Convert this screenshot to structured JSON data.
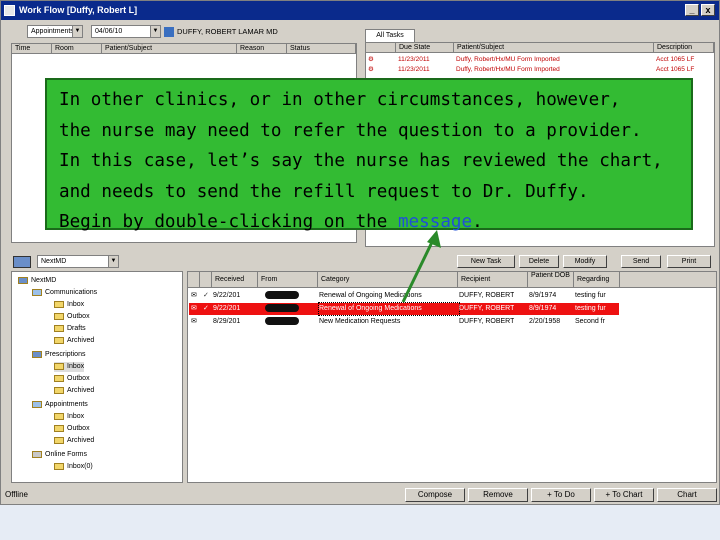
{
  "window": {
    "title": "Work Flow [Duffy, Robert L]",
    "minimize": "_",
    "close": "x"
  },
  "appointments": {
    "combo_label": "Appointments",
    "date_value": "04/06/10",
    "provider": "DUFFY, ROBERT LAMAR MD",
    "columns": [
      "Time",
      "Room",
      "Patient/Subject",
      "Reason",
      "Status"
    ]
  },
  "tasks": {
    "tab_label": "All Tasks",
    "columns": [
      "",
      "Due State",
      "Patient/Subject",
      "Description"
    ],
    "rows": [
      {
        "date": "11/23/2011",
        "subject": "Duffy, Robert/Hx/MU Form Imported",
        "desc": "Acct 1065 LF"
      },
      {
        "date": "11/23/2011",
        "subject": "Duffy, Robert/Hx/MU Form Imported",
        "desc": "Acct 1065 LF"
      }
    ]
  },
  "messages_toolbar": {
    "new_task": "New Task",
    "delete": "Delete",
    "modify": "Modify",
    "send": "Send",
    "print": "Print"
  },
  "tree": {
    "combo_value": "NextMD",
    "root": "NextMD",
    "nodes": [
      {
        "label": "Communications",
        "children": [
          "Inbox",
          "Outbox",
          "Drafts",
          "Archived"
        ]
      },
      {
        "label": "Prescriptions",
        "children": [
          "Inbox",
          "Outbox",
          "Archived"
        ]
      },
      {
        "label": "Appointments",
        "children": [
          "Inbox",
          "Outbox",
          "Archived"
        ]
      },
      {
        "label": "Online Forms",
        "children": [
          "Inbox(0)"
        ]
      }
    ]
  },
  "messages": {
    "columns": [
      "",
      "",
      "Received",
      "From",
      "Category",
      "Recipient",
      "Patient DOB",
      "Regarding"
    ],
    "rows": [
      {
        "received": "9/22/201",
        "category": "Renewal of Ongoing Medications",
        "recipient": "DUFFY, ROBERT",
        "dob": "8/9/1974",
        "regarding": "testing fur",
        "selected": false
      },
      {
        "received": "9/22/201",
        "category": "Renewal of Ongoing Medications",
        "recipient": "DUFFY, ROBERT",
        "dob": "8/9/1974",
        "regarding": "testing fur",
        "selected": true
      },
      {
        "received": "8/29/201",
        "category": "New Medication Requests",
        "recipient": "DUFFY, ROBERT",
        "dob": "2/20/1958",
        "regarding": "Second fr",
        "selected": false
      }
    ]
  },
  "buttons": {
    "compose": "Compose",
    "remove": "Remove",
    "to_do": "+ To Do",
    "to_chart": "+ To Chart",
    "chart": "Chart"
  },
  "status_text": "Offline",
  "callout": {
    "line1": "In other clinics, or in other circumstances, however,",
    "line2": "the nurse may need to refer the question to a provider.",
    "line3": "In this case, let’s say the nurse has reviewed the chart,",
    "line4": "and needs to send the refill request to Dr. Duffy.",
    "line5_prefix": "Begin by double-clicking on the ",
    "line5_highlight": "message",
    "line5_suffix": "."
  },
  "colors": {
    "callout_bg": "#33bb33",
    "highlight": "#1f4fd8",
    "selected_row": "#ee1111",
    "arrow": "#2a8a2a"
  }
}
